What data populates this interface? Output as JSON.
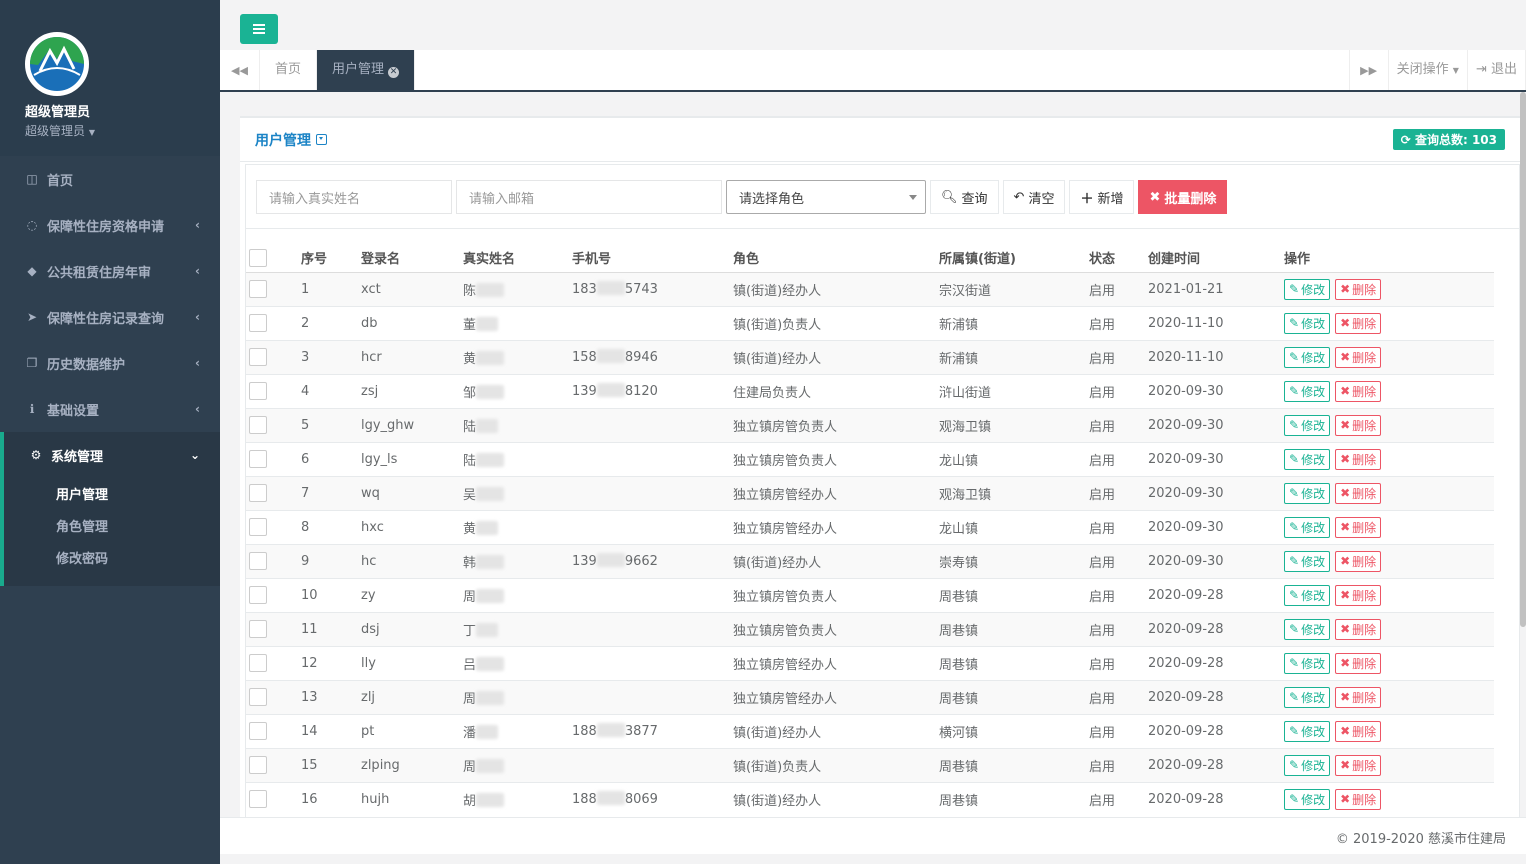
{
  "profile": {
    "name": "超级管理员",
    "role": "超级管理员"
  },
  "nav": [
    {
      "label": "首页",
      "icon": "columns-icon"
    },
    {
      "label": "保障性住房资格申请",
      "icon": "chat-icon"
    },
    {
      "label": "公共租赁住房年审",
      "icon": "tag-icon"
    },
    {
      "label": "保障性住房记录查询",
      "icon": "send-icon"
    },
    {
      "label": "历史数据维护",
      "icon": "copy-icon"
    },
    {
      "label": "基础设置",
      "icon": "info-icon"
    },
    {
      "label": "系统管理",
      "icon": "gear-icon"
    }
  ],
  "subnav": [
    "用户管理",
    "角色管理",
    "修改密码"
  ],
  "tabs": {
    "home": "首页",
    "current": "用户管理",
    "close_ops": "关闭操作",
    "logout": "退出"
  },
  "panel": {
    "title": "用户管理",
    "total": "查询总数: 103"
  },
  "filters": {
    "name_placeholder": "请输入真实姓名",
    "email_placeholder": "请输入邮箱",
    "role_select": "请选择角色",
    "query": "查询",
    "clear": "清空",
    "add": "新增",
    "batch_delete": "批量删除"
  },
  "columns": [
    "序号",
    "登录名",
    "真实姓名",
    "手机号",
    "角色",
    "所属镇(街道)",
    "状态",
    "创建时间",
    "操作"
  ],
  "actions": {
    "edit": "修改",
    "delete": "删除"
  },
  "rows": [
    {
      "no": "1",
      "login": "xct",
      "name": "陈",
      "phone_a": "183",
      "phone_b": "5743",
      "role": "镇(街道)经办人",
      "town": "宗汉街道",
      "status": "启用",
      "date": "2021-01-21"
    },
    {
      "no": "2",
      "login": "db",
      "name": "董",
      "phone_a": "",
      "phone_b": "",
      "role": "镇(街道)负责人",
      "town": "新浦镇",
      "status": "启用",
      "date": "2020-11-10"
    },
    {
      "no": "3",
      "login": "hcr",
      "name": "黄",
      "phone_a": "158",
      "phone_b": "8946",
      "role": "镇(街道)经办人",
      "town": "新浦镇",
      "status": "启用",
      "date": "2020-11-10"
    },
    {
      "no": "4",
      "login": "zsj",
      "name": "邹",
      "phone_a": "139",
      "phone_b": "8120",
      "role": "住建局负责人",
      "town": "浒山街道",
      "status": "启用",
      "date": "2020-09-30"
    },
    {
      "no": "5",
      "login": "lgy_ghw",
      "name": "陆",
      "phone_a": "",
      "phone_b": "",
      "role": "独立镇房管负责人",
      "town": "观海卫镇",
      "status": "启用",
      "date": "2020-09-30"
    },
    {
      "no": "6",
      "login": "lgy_ls",
      "name": "陆",
      "phone_a": "",
      "phone_b": "",
      "role": "独立镇房管负责人",
      "town": "龙山镇",
      "status": "启用",
      "date": "2020-09-30"
    },
    {
      "no": "7",
      "login": "wq",
      "name": "吴",
      "phone_a": "",
      "phone_b": "",
      "role": "独立镇房管经办人",
      "town": "观海卫镇",
      "status": "启用",
      "date": "2020-09-30"
    },
    {
      "no": "8",
      "login": "hxc",
      "name": "黄",
      "phone_a": "",
      "phone_b": "",
      "role": "独立镇房管经办人",
      "town": "龙山镇",
      "status": "启用",
      "date": "2020-09-30"
    },
    {
      "no": "9",
      "login": "hc",
      "name": "韩",
      "phone_a": "139",
      "phone_b": "9662",
      "role": "镇(街道)经办人",
      "town": "崇寿镇",
      "status": "启用",
      "date": "2020-09-30"
    },
    {
      "no": "10",
      "login": "zy",
      "name": "周",
      "phone_a": "",
      "phone_b": "",
      "role": "独立镇房管负责人",
      "town": "周巷镇",
      "status": "启用",
      "date": "2020-09-28"
    },
    {
      "no": "11",
      "login": "dsj",
      "name": "丁",
      "phone_a": "",
      "phone_b": "",
      "role": "独立镇房管负责人",
      "town": "周巷镇",
      "status": "启用",
      "date": "2020-09-28"
    },
    {
      "no": "12",
      "login": "lly",
      "name": "吕",
      "phone_a": "",
      "phone_b": "",
      "role": "独立镇房管经办人",
      "town": "周巷镇",
      "status": "启用",
      "date": "2020-09-28"
    },
    {
      "no": "13",
      "login": "zlj",
      "name": "周",
      "phone_a": "",
      "phone_b": "",
      "role": "独立镇房管经办人",
      "town": "周巷镇",
      "status": "启用",
      "date": "2020-09-28"
    },
    {
      "no": "14",
      "login": "pt",
      "name": "潘",
      "phone_a": "188",
      "phone_b": "3877",
      "role": "镇(街道)经办人",
      "town": "横河镇",
      "status": "启用",
      "date": "2020-09-28"
    },
    {
      "no": "15",
      "login": "zlping",
      "name": "周",
      "phone_a": "",
      "phone_b": "",
      "role": "镇(街道)负责人",
      "town": "周巷镇",
      "status": "启用",
      "date": "2020-09-28"
    },
    {
      "no": "16",
      "login": "hujh",
      "name": "胡",
      "phone_a": "188",
      "phone_b": "8069",
      "role": "镇(街道)经办人",
      "town": "周巷镇",
      "status": "启用",
      "date": "2020-09-28"
    }
  ],
  "footer": "© 2019-2020 慈溪市住建局",
  "colors": {
    "sidebar": "#2f4050",
    "accent": "#1ab394",
    "danger": "#ed5565",
    "link": "#1c84c6"
  }
}
